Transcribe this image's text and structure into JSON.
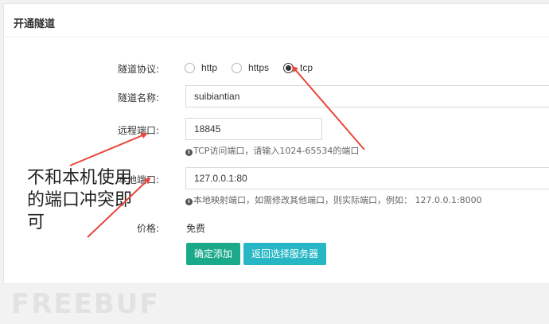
{
  "panel": {
    "title": "开通隧道"
  },
  "form": {
    "protocol": {
      "label": "隧道协议:",
      "options": [
        {
          "label": "http",
          "checked": false
        },
        {
          "label": "https",
          "checked": false
        },
        {
          "label": "tcp",
          "checked": true
        }
      ]
    },
    "tunnel_name": {
      "label": "隧道名称:",
      "value": "suibiantian"
    },
    "remote_port": {
      "label": "远程端口:",
      "value": "18845",
      "hint": "TCP访问端口，请输入1024-65534的端口"
    },
    "local_port": {
      "label": "本地端口:",
      "value": "127.0.0.1:80",
      "hint": "本地映射端口，如需修改其他端口，则实际端口，例如： 127.0.0.1:8000"
    },
    "price": {
      "label": "价格:",
      "value": "免费"
    }
  },
  "buttons": {
    "confirm_label": "确定添加",
    "back_label": "返回选择服务器"
  },
  "annotation": {
    "text": "不和本机使用的端口冲突即可",
    "color": "#e8473a"
  },
  "watermark": "FREEBUF",
  "colors": {
    "primary_button": "#1aaa8a",
    "secondary_button": "#26b6c6",
    "arrow": "#e8473a"
  }
}
